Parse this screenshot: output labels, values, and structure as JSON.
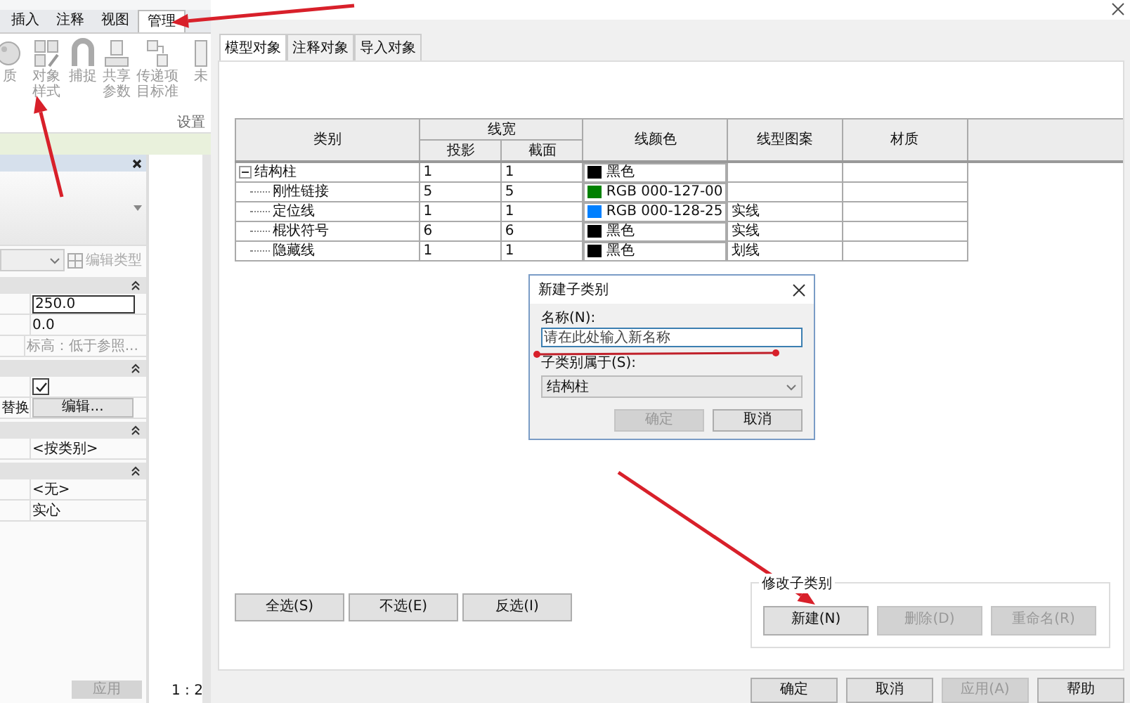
{
  "ribbon": {
    "tabs": [
      {
        "label": "插入",
        "selected": false
      },
      {
        "label": "注释",
        "selected": false
      },
      {
        "label": "视图",
        "selected": false
      },
      {
        "label": "管理",
        "selected": true
      }
    ],
    "tools": [
      {
        "kind": "material",
        "label": "质"
      },
      {
        "kind": "styles",
        "label": "对象样式"
      },
      {
        "kind": "snap",
        "label": "捕捉"
      },
      {
        "kind": "shared",
        "label": "共享参数"
      },
      {
        "kind": "transfer",
        "label": "传递项目标准"
      },
      {
        "kind": "purge",
        "label": "未"
      }
    ],
    "group_label": "设置"
  },
  "properties": {
    "edit_type": "编辑类型",
    "apply": "应用",
    "groups": [
      {
        "expanded": true,
        "rows": [
          {
            "kind": "field",
            "value": "250.0"
          },
          {
            "kind": "text",
            "value": "0.0"
          },
          {
            "kind": "hint",
            "value": "标高：低于参照..."
          }
        ]
      },
      {
        "expanded": true,
        "rows": [
          {
            "kind": "checkbox",
            "checked": true
          },
          {
            "kind": "button",
            "label": "替换",
            "value": "编辑..."
          }
        ]
      },
      {
        "expanded": true,
        "rows": [
          {
            "kind": "text",
            "value": "<按类别>"
          }
        ]
      },
      {
        "expanded": true,
        "rows": [
          {
            "kind": "text",
            "value": "<无>"
          },
          {
            "kind": "text",
            "value": "实心"
          }
        ]
      }
    ]
  },
  "view": {
    "scale": "1 : 2"
  },
  "dialog": {
    "tabs": [
      {
        "label": "模型对象",
        "selected": true
      },
      {
        "label": "注释对象",
        "selected": false
      },
      {
        "label": "导入对象",
        "selected": false
      }
    ],
    "table": {
      "columns": [
        "类别",
        "线宽",
        "线颜色",
        "线型图案",
        "材质"
      ],
      "subcolumns": [
        "投影",
        "截面"
      ],
      "rows": [
        {
          "name": "结构柱",
          "projection": "1",
          "cut": "1",
          "color": "#000000",
          "color_name": "黑色",
          "expanded": true,
          "children": [
            {
              "name": "刚性链接",
              "projection": "5",
              "cut": "5",
              "color": "#008000",
              "color_name": "RGB 000-127-00"
            },
            {
              "name": "定位线",
              "projection": "1",
              "cut": "1",
              "color": "#0080ff",
              "color_name": "RGB 000-128-25",
              "pattern": "实线"
            },
            {
              "name": "棍状符号",
              "projection": "6",
              "cut": "6",
              "color": "#000000",
              "color_name": "黑色",
              "pattern": "实线"
            },
            {
              "name": "隐藏线",
              "projection": "1",
              "cut": "1",
              "color": "#000000",
              "color_name": "黑色",
              "pattern": "划线"
            }
          ]
        }
      ]
    },
    "select_buttons": [
      "全选(S)",
      "不选(E)",
      "反选(I)"
    ],
    "modify": {
      "title": "修改子类别",
      "buttons": [
        {
          "label": "新建(N)",
          "disabled": false
        },
        {
          "label": "删除(D)",
          "disabled": true
        },
        {
          "label": "重命名(R)",
          "disabled": true
        }
      ]
    },
    "footer": [
      {
        "label": "确定",
        "disabled": false
      },
      {
        "label": "取消",
        "disabled": false
      },
      {
        "label": "应用(A)",
        "disabled": true
      },
      {
        "label": "帮助",
        "disabled": false
      }
    ]
  },
  "subdialog": {
    "title": "新建子类别",
    "name_label": "名称(N):",
    "name_placeholder": "请在此处输入新名称",
    "parent_label": "子类别属于(S):",
    "parent_value": "结构柱",
    "buttons": [
      {
        "label": "确定",
        "disabled": true
      },
      {
        "label": "取消",
        "disabled": false
      }
    ]
  }
}
